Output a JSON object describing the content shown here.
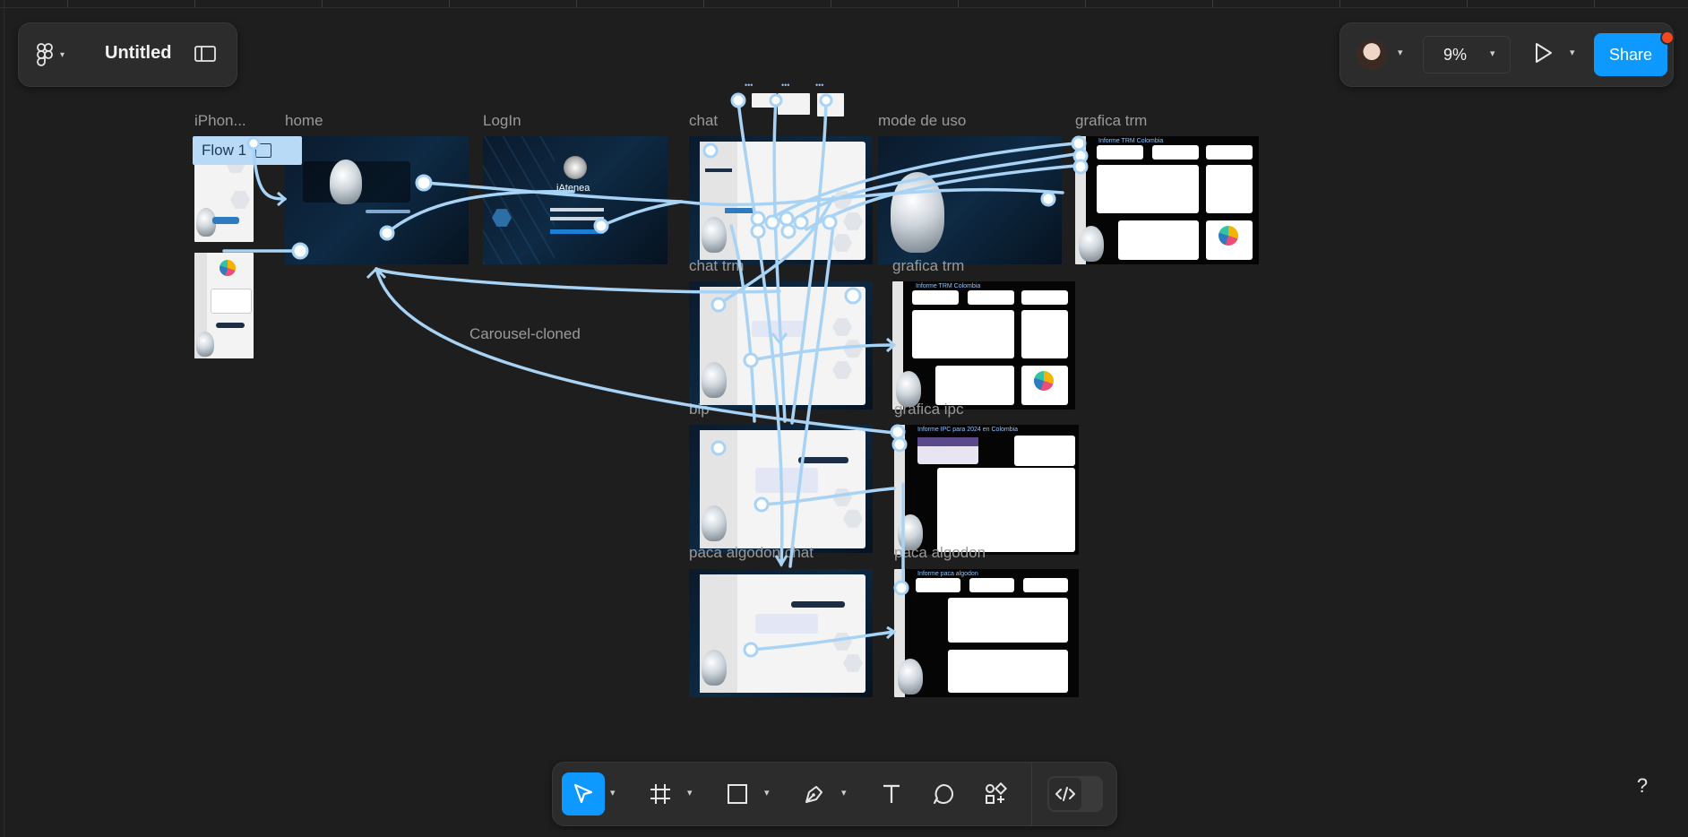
{
  "file": {
    "title": "Untitled"
  },
  "header": {
    "zoom": "9%",
    "share_label": "Share"
  },
  "flow": {
    "label": "Flow 1"
  },
  "frames": {
    "iphone": "iPhon...",
    "home": "home",
    "login": "LogIn",
    "chat": "chat",
    "mode_de_uso": "mode de uso",
    "grafica_trm": "grafica trm",
    "chat_trm": "chat trm",
    "grafica_trm_2": "grafica trm",
    "bip": "bip",
    "grafica_ipc": "grafica ipc",
    "paca_algodon_chat": "paca algodon chat",
    "paca_algodon": "paca algodon",
    "carousel": "Carousel-cloned"
  },
  "mini_text": {
    "iatenea": "iAtenea",
    "informe_trm": "Informe TRM Colombia",
    "informe_ipc": "Informe IPC para 2024 en Colombia",
    "informe_paca": "Informe paca algodon"
  },
  "help": {
    "label": "?"
  },
  "icons": {
    "figma_menu": "figma-logo-icon",
    "sidebar_toggle": "sidebar-toggle-icon",
    "present": "play-icon",
    "move": "cursor-icon",
    "frame": "frame-icon",
    "shape": "rectangle-icon",
    "pen": "pen-icon",
    "text": "text-icon",
    "comment": "comment-icon",
    "actions": "actions-icon",
    "dev_mode": "code-icon"
  },
  "colors": {
    "accent": "#0d99ff",
    "connector": "#a8d3f5",
    "canvas": "#1e1e1e",
    "panel": "#2c2c2c"
  }
}
